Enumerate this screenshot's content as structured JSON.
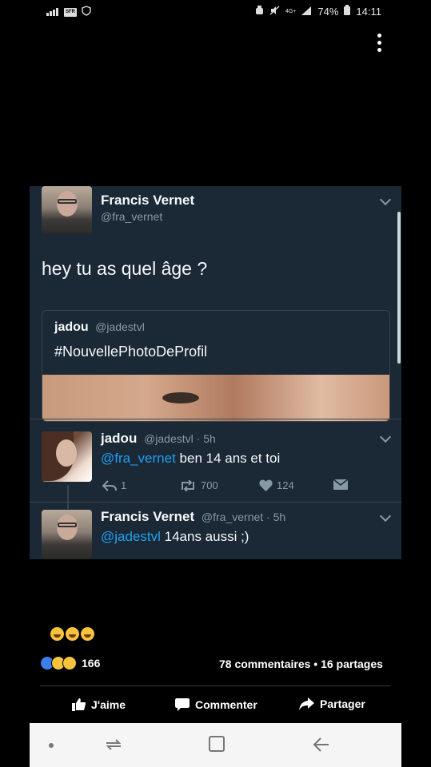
{
  "status_bar": {
    "carrier": "SFR",
    "network": "4G+",
    "battery": "74%",
    "time": "14:11"
  },
  "tweet": {
    "author_name": "Francis Vernet",
    "author_handle": "@fra_vernet",
    "text": "hey tu as quel âge ?",
    "quote": {
      "name": "jadou",
      "handle": "@jadestvl",
      "text": "#NouvellePhotoDeProfil"
    }
  },
  "reply1": {
    "name": "jadou",
    "handle": "@jadestvl · 5h",
    "mention": "@fra_vernet",
    "text": " ben 14 ans et toi",
    "replies": "1",
    "retweets": "700",
    "likes": "124"
  },
  "reply2": {
    "name": "Francis Vernet",
    "handle": "@fra_vernet · 5h",
    "mention": "@jadestvl",
    "text": " 14ans aussi ;)"
  },
  "post": {
    "caption_emojis": "😂😂😂",
    "reactions_count": "166",
    "comments_shares": "78 commentaires • 16 partages",
    "like_label": "J'aime",
    "comment_label": "Commenter",
    "share_label": "Partager"
  }
}
